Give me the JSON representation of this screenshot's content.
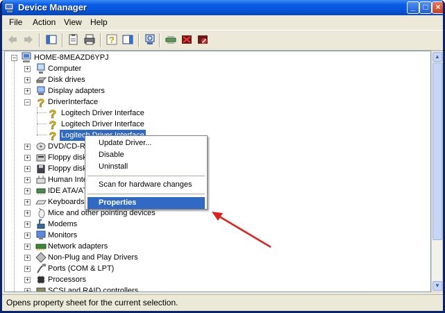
{
  "window": {
    "title": "Device Manager",
    "minimize": "_",
    "maximize": "□",
    "close": "×"
  },
  "menu": [
    "File",
    "Action",
    "View",
    "Help"
  ],
  "toolbar": {
    "buttons": [
      "back-icon",
      "forward-icon",
      "show-hide-console-tree-icon",
      "properties-icon",
      "print-icon",
      "help-icon",
      "show-action-pane-icon",
      "scan-hardware-icon",
      "update-driver-icon",
      "uninstall-icon",
      "disable-icon"
    ]
  },
  "tree": {
    "root": "HOME-8MEAZD6YPJ",
    "items": [
      {
        "label": "Computer",
        "icon": "computer-icon"
      },
      {
        "label": "Disk drives",
        "icon": "disk-drive-icon"
      },
      {
        "label": "Display adapters",
        "icon": "display-adapter-icon"
      },
      {
        "label": "DriverInterface",
        "icon": "unknown-device-icon",
        "expanded": true,
        "children": [
          "Logitech Driver Interface",
          "Logitech Driver Interface",
          "Logitech Driver Interface"
        ]
      },
      {
        "label": "DVD/CD-RO",
        "icon": "dvd-drive-icon"
      },
      {
        "label": "Floppy disk",
        "icon": "floppy-controller-icon"
      },
      {
        "label": "Floppy disk",
        "icon": "floppy-drive-icon"
      },
      {
        "label": "Human Inte",
        "icon": "hid-icon"
      },
      {
        "label": "IDE ATA/AT",
        "icon": "ide-controller-icon"
      },
      {
        "label": "Keyboards",
        "icon": "keyboard-icon"
      },
      {
        "label": "Mice and other pointing devices",
        "icon": "mouse-icon"
      },
      {
        "label": "Modems",
        "icon": "modem-icon"
      },
      {
        "label": "Monitors",
        "icon": "monitor-icon"
      },
      {
        "label": "Network adapters",
        "icon": "network-adapter-icon"
      },
      {
        "label": "Non-Plug and Play Drivers",
        "icon": "non-pnp-driver-icon"
      },
      {
        "label": "Ports (COM & LPT)",
        "icon": "port-icon"
      },
      {
        "label": "Processors",
        "icon": "processor-icon"
      },
      {
        "label": "SCSI and RAID controllers",
        "icon": "scsi-controller-icon"
      }
    ]
  },
  "context_menu": {
    "items": [
      "Update Driver...",
      "Disable",
      "Uninstall",
      "Scan for hardware changes",
      "Properties"
    ],
    "highlighted": "Properties"
  },
  "status": "Opens property sheet for the current selection.",
  "colors": {
    "selection": "#316ac5",
    "titlebar": "#0554d8",
    "arrow": "#e0201b"
  }
}
